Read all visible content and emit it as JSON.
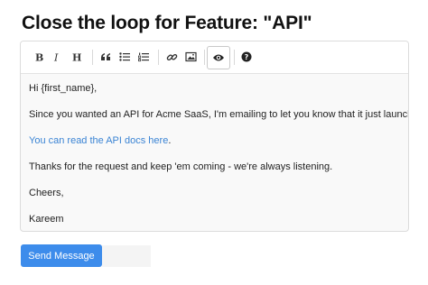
{
  "page": {
    "title": "Close the loop for Feature: \"API\""
  },
  "toolbar": {
    "buttons": [
      {
        "icon": "bold-icon"
      },
      {
        "icon": "italic-icon"
      },
      {
        "icon": "heading-icon"
      },
      {
        "icon": "quote-icon"
      },
      {
        "icon": "unordered-list-icon"
      },
      {
        "icon": "ordered-list-icon"
      },
      {
        "icon": "link-icon"
      },
      {
        "icon": "image-icon"
      },
      {
        "icon": "preview-eye-icon",
        "active": true
      },
      {
        "icon": "help-icon"
      }
    ]
  },
  "message": {
    "greeting": "Hi {first_name},",
    "body": "Since you wanted an API for Acme SaaS, I'm emailing to let you know that it just launched.",
    "link_text": "You can read the API docs here",
    "link_suffix": ".",
    "thanks": "Thanks for the request and keep 'em coming - we're always listening.",
    "signoff": "Cheers,",
    "signature": "Kareem"
  },
  "actions": {
    "send_label": "Send Message"
  },
  "colors": {
    "accent": "#3d8ceb",
    "link": "#3b84d4"
  }
}
